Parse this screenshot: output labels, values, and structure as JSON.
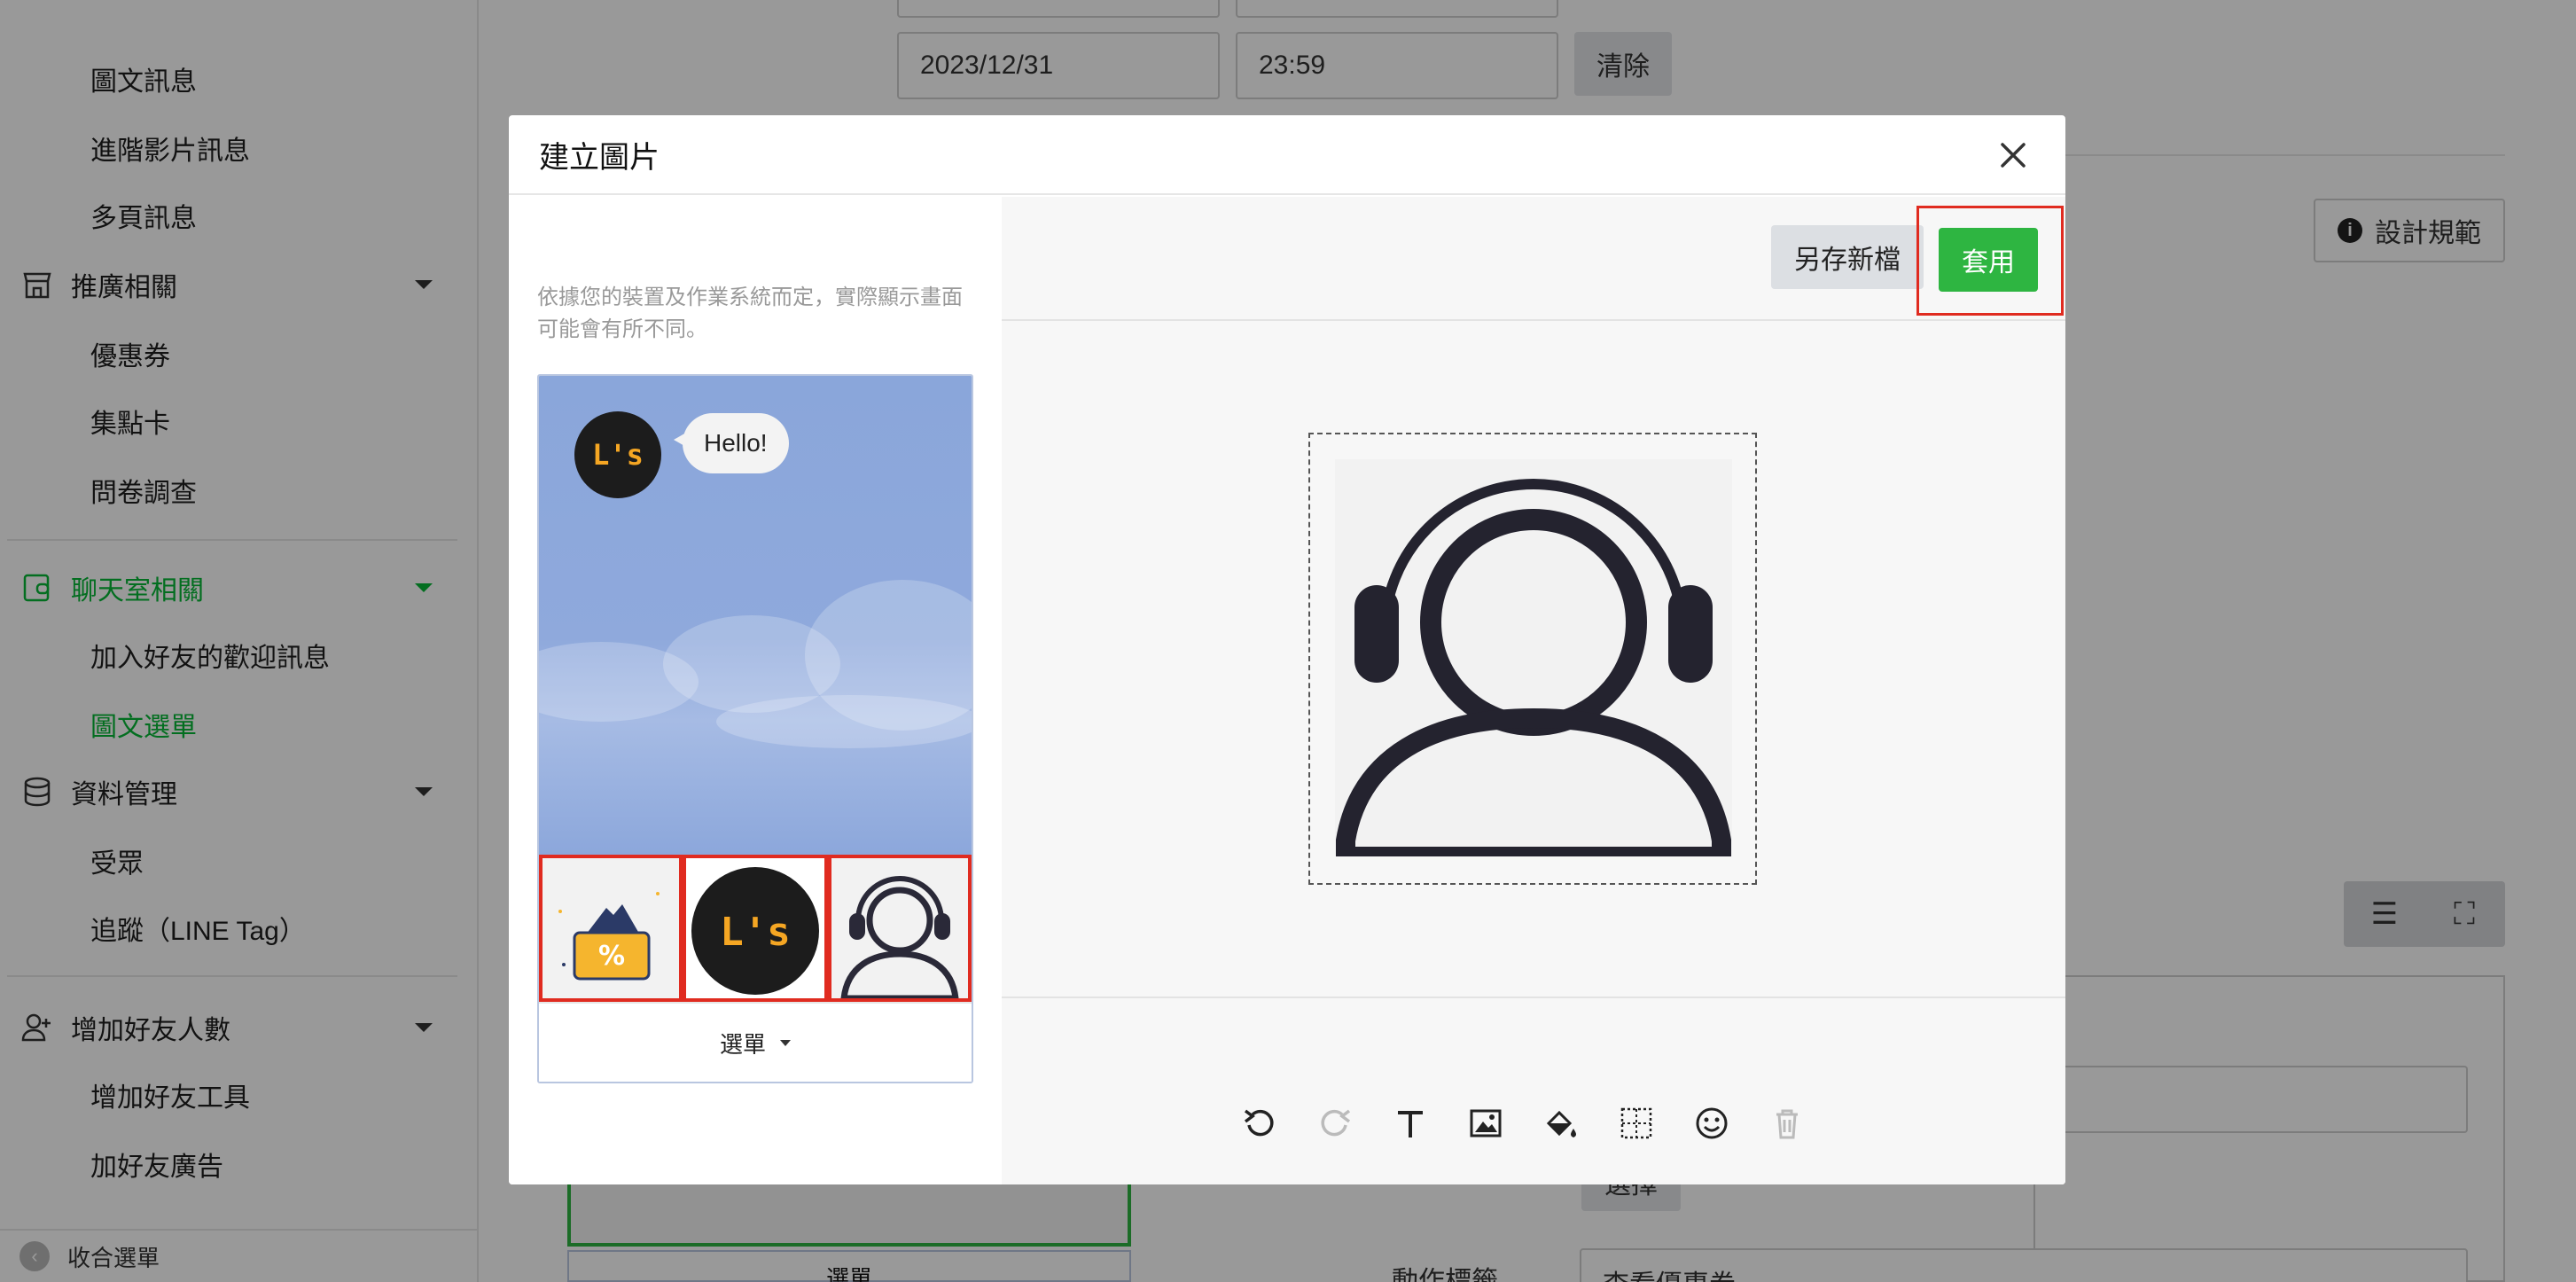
{
  "sidebar": {
    "items": [
      {
        "label": "圖文訊息"
      },
      {
        "label": "進階影片訊息"
      },
      {
        "label": "多頁訊息"
      },
      {
        "label": "推廣相關"
      },
      {
        "label": "優惠券"
      },
      {
        "label": "集點卡"
      },
      {
        "label": "問卷調查"
      },
      {
        "label": "聊天室相關"
      },
      {
        "label": "加入好友的歡迎訊息"
      },
      {
        "label": "圖文選單"
      },
      {
        "label": "資料管理"
      },
      {
        "label": "受眾"
      },
      {
        "label": "追蹤（LINE Tag）"
      },
      {
        "label": "增加好友人數"
      },
      {
        "label": "增加好友工具"
      },
      {
        "label": "加好友廣告"
      }
    ],
    "collapse_label": "收合選單"
  },
  "background": {
    "end_date": "2023/12/31",
    "end_time": "23:59",
    "clear_label": "清除",
    "design_spec_label": "設計規範",
    "action_label_label": "動作標籤",
    "action_label_value": "查看優惠券",
    "select_label": "選擇",
    "menu_label": "選單"
  },
  "modal": {
    "title": "建立圖片",
    "note": "依據您的裝置及作業系統而定，實際顯示畫面可能會有所不同。",
    "chat_bubble": "Hello!",
    "avatar_text": "L's",
    "menu_bar_label": "選單",
    "save_new_label": "另存新檔",
    "apply_label": "套用",
    "toolbar_icons": [
      "undo-icon",
      "redo-icon",
      "text-icon",
      "image-icon",
      "fill-icon",
      "grid-icon",
      "emoji-icon",
      "trash-icon"
    ]
  },
  "colors": {
    "accent_green": "#06b836",
    "apply_green": "#2eb541",
    "highlight_red": "#e02b20",
    "chat_blue": "#8fa9dc"
  }
}
